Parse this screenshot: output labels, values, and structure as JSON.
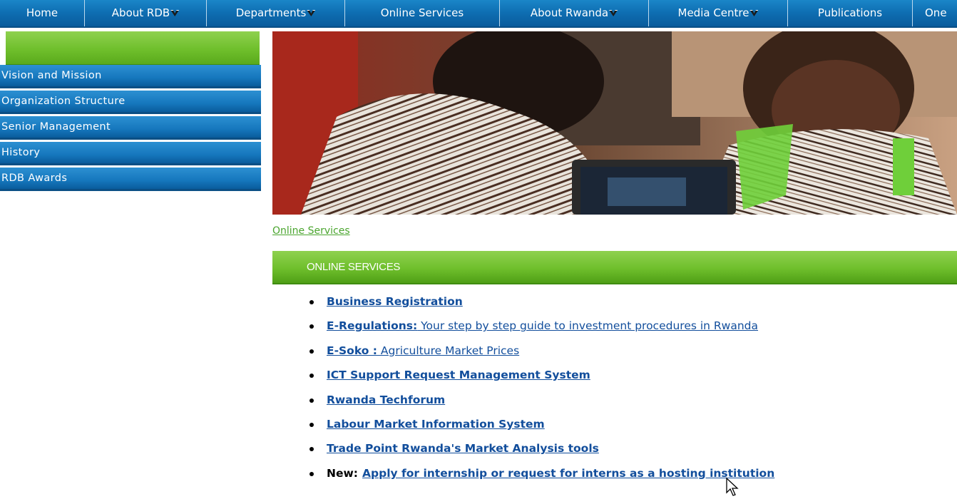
{
  "topnav": {
    "items": [
      {
        "label": "Home",
        "dropdown": false
      },
      {
        "label": "About RDB",
        "dropdown": true
      },
      {
        "label": "Departments",
        "dropdown": true
      },
      {
        "label": "Online Services",
        "dropdown": false
      },
      {
        "label": "About Rwanda",
        "dropdown": true
      },
      {
        "label": "Media Centre",
        "dropdown": true
      },
      {
        "label": "Publications",
        "dropdown": false
      },
      {
        "label": "One",
        "dropdown": false
      }
    ]
  },
  "sidebar": {
    "items": [
      {
        "label": "Vision and Mission"
      },
      {
        "label": "Organization Structure"
      },
      {
        "label": "Senior Management"
      },
      {
        "label": "History"
      },
      {
        "label": "RDB Awards"
      }
    ]
  },
  "breadcrumb": "Online Services",
  "section": {
    "title": "ONLINE SERVICES",
    "items": [
      {
        "link": "Business Registration",
        "desc": ""
      },
      {
        "link": "E-Regulations:",
        "desc": " Your step by step guide to investment procedures in Rwanda"
      },
      {
        "link": "E-Soko :",
        "desc": " Agriculture Market Prices"
      },
      {
        "link": "ICT Support Request Management System",
        "desc": ""
      },
      {
        "link": "Rwanda Techforum",
        "desc": ""
      },
      {
        "link": "Labour Market Information System",
        "desc": ""
      },
      {
        "link": "Trade Point Rwanda's Market Analysis tools",
        "desc": ""
      }
    ],
    "new_item": {
      "label": "New:",
      "link": "Apply for internship or request for interns as a hosting institution"
    }
  },
  "colors": {
    "nav_blue": "#0e6db1",
    "sidebar_green": "#6fbf2c",
    "link_blue": "#124e9c",
    "breadcrumb_green": "#4aa52e"
  }
}
